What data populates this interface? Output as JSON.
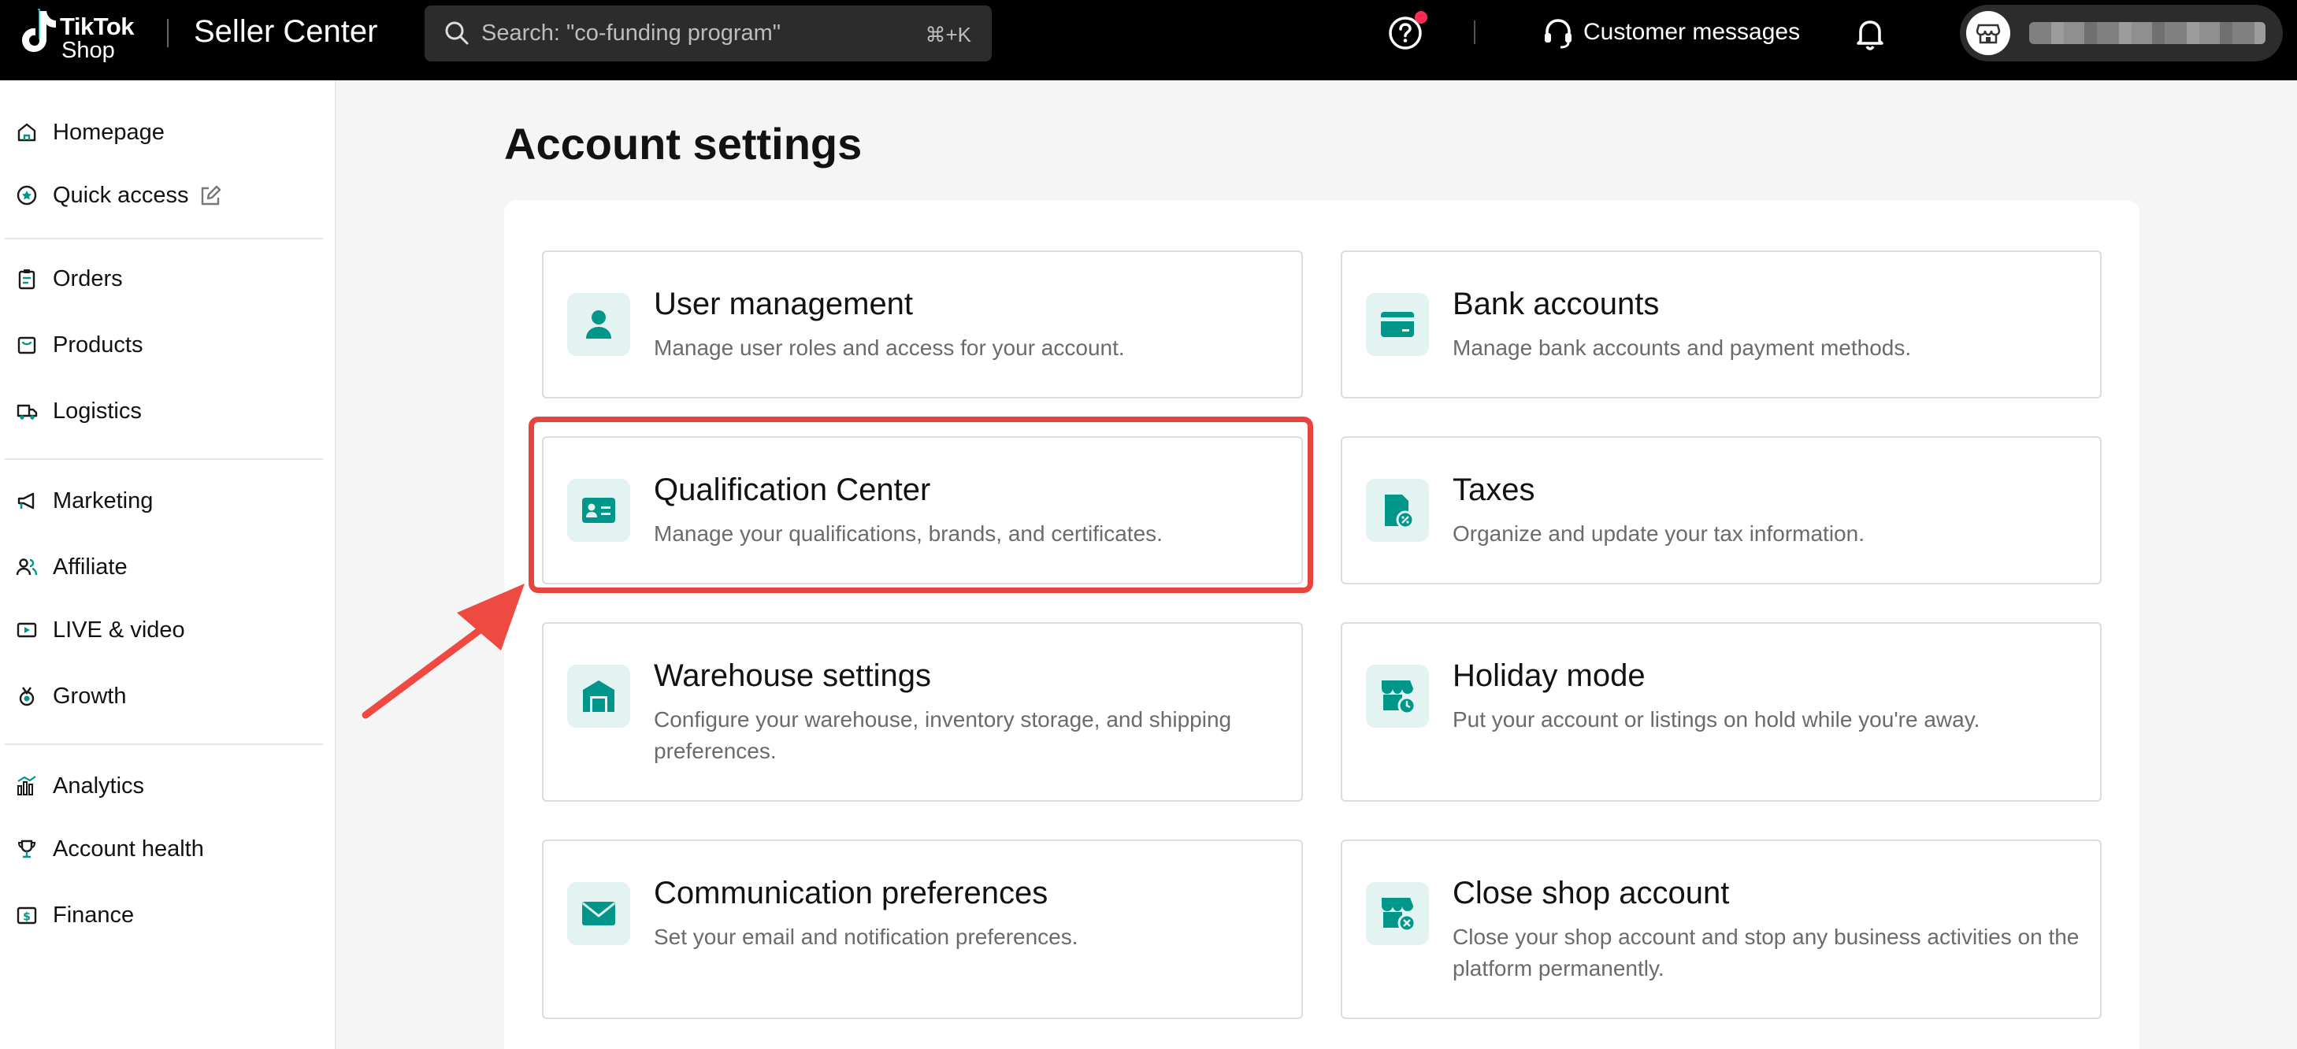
{
  "header": {
    "logo_line1": "TikTok",
    "logo_line2": "Shop",
    "title": "Seller Center",
    "search_placeholder": "Search: \"co-funding program\"",
    "search_shortcut": "⌘+K",
    "customer_messages": "Customer messages"
  },
  "sidebar": {
    "items": [
      {
        "label": "Homepage",
        "icon": "home-icon"
      },
      {
        "label": "Quick access",
        "icon": "star-circle-icon"
      },
      {
        "label": "Orders",
        "icon": "clipboard-icon"
      },
      {
        "label": "Products",
        "icon": "product-box-icon"
      },
      {
        "label": "Logistics",
        "icon": "truck-icon"
      },
      {
        "label": "Marketing",
        "icon": "megaphone-icon"
      },
      {
        "label": "Affiliate",
        "icon": "people-icon"
      },
      {
        "label": "LIVE & video",
        "icon": "video-icon"
      },
      {
        "label": "Growth",
        "icon": "medal-icon"
      },
      {
        "label": "Analytics",
        "icon": "bar-chart-icon"
      },
      {
        "label": "Account health",
        "icon": "trophy-icon"
      },
      {
        "label": "Finance",
        "icon": "dollar-icon"
      }
    ]
  },
  "main": {
    "title": "Account settings",
    "cards": [
      {
        "title": "User management",
        "desc": "Manage user roles and access for your account.",
        "icon": "user-icon"
      },
      {
        "title": "Bank accounts",
        "desc": "Manage bank accounts and payment methods.",
        "icon": "bank-card-icon"
      },
      {
        "title": "Qualification Center",
        "desc": "Manage your qualifications, brands, and certificates.",
        "icon": "id-card-icon"
      },
      {
        "title": "Taxes",
        "desc": "Organize and update your tax information.",
        "icon": "tax-document-icon"
      },
      {
        "title": "Warehouse settings",
        "desc": "Configure your warehouse, inventory storage, and shipping preferences.",
        "icon": "warehouse-icon"
      },
      {
        "title": "Holiday mode",
        "desc": "Put your account or listings on hold while you're away.",
        "icon": "store-clock-icon"
      },
      {
        "title": "Communication preferences",
        "desc": "Set your email and notification preferences.",
        "icon": "envelope-icon"
      },
      {
        "title": "Close shop account",
        "desc": "Close your shop account and stop any business activities on the platform permanently.",
        "icon": "store-close-icon"
      }
    ]
  },
  "colors": {
    "accent_teal": "#00968a",
    "icon_bg": "#e3f3f1",
    "highlight_red": "#e8443e",
    "notification_dot": "#fe2c55"
  }
}
